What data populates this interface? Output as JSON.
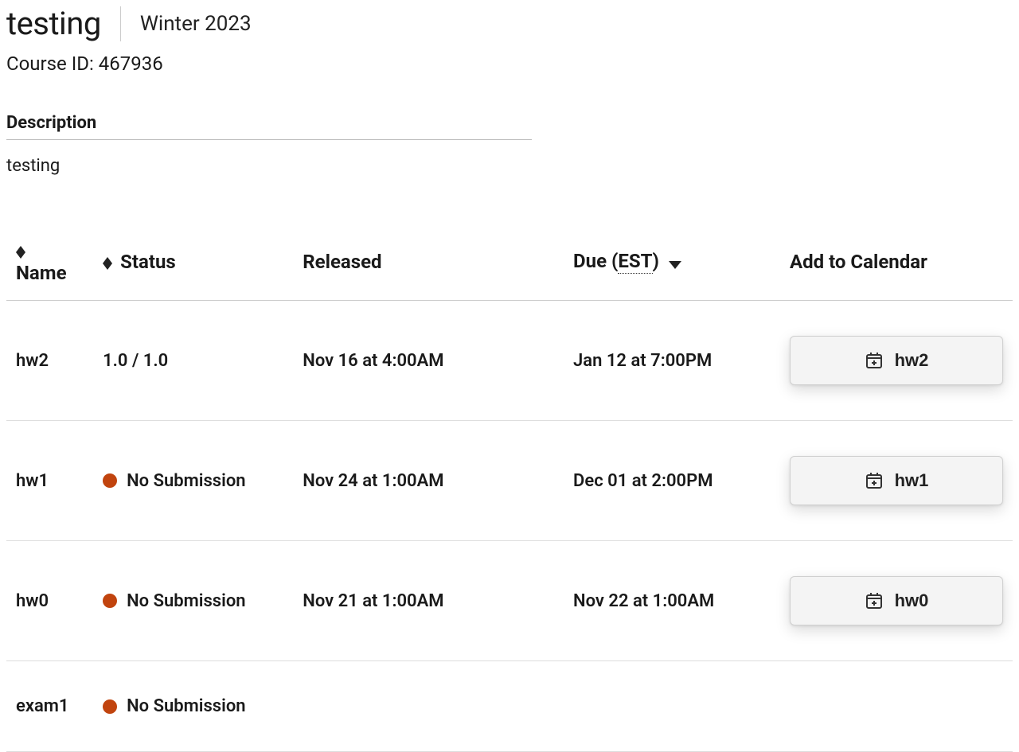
{
  "header": {
    "title": "testing",
    "term": "Winter 2023",
    "course_id_label": "Course ID: 467936"
  },
  "description": {
    "label": "Description",
    "text": "testing"
  },
  "table": {
    "columns": {
      "name": "Name",
      "status": "Status",
      "released": "Released",
      "due_prefix": "Due (",
      "due_tz": "EST",
      "due_suffix": ")",
      "calendar": "Add to Calendar"
    },
    "no_submission_text": "No Submission",
    "rows": [
      {
        "name": "hw2",
        "status_type": "score",
        "status_text": "1.0 / 1.0",
        "released": "Nov 16 at 4:00AM",
        "due": "Jan 12 at 7:00PM",
        "cal_label": "hw2",
        "has_cal": true
      },
      {
        "name": "hw1",
        "status_type": "none",
        "status_text": "No Submission",
        "released": "Nov 24 at 1:00AM",
        "due": "Dec 01 at 2:00PM",
        "cal_label": "hw1",
        "has_cal": true
      },
      {
        "name": "hw0",
        "status_type": "none",
        "status_text": "No Submission",
        "released": "Nov 21 at 1:00AM",
        "due": "Nov 22 at 1:00AM",
        "cal_label": "hw0",
        "has_cal": true
      },
      {
        "name": "exam1",
        "status_type": "none",
        "status_text": "No Submission",
        "released": "",
        "due": "",
        "cal_label": "",
        "has_cal": false
      }
    ]
  }
}
